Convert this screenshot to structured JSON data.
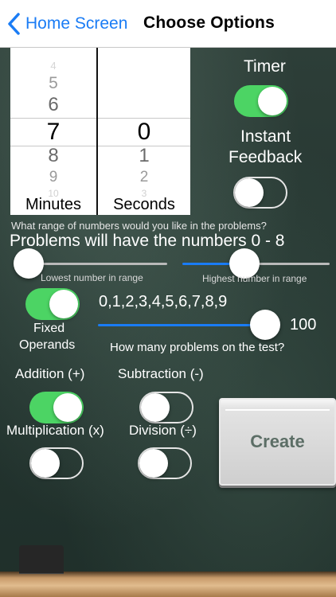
{
  "nav": {
    "back_label": "Home Screen",
    "title": "Choose Options"
  },
  "picker": {
    "minutes_label": "Minutes",
    "seconds_label": "Seconds",
    "minutes_values": [
      "4",
      "5",
      "6",
      "7",
      "8",
      "9",
      "10"
    ],
    "seconds_values": [
      "0",
      "1",
      "2",
      "3"
    ],
    "minutes_selected": "7",
    "seconds_selected": "0"
  },
  "timer": {
    "label": "Timer",
    "on": true
  },
  "instant_feedback": {
    "label_line1": "Instant",
    "label_line2": "Feedback",
    "on": false
  },
  "range": {
    "question": "What range of numbers would you like in the problems?",
    "summary": "Problems will have the numbers 0 - 8",
    "lowest_label": "Lowest number in range",
    "highest_label": "Highest number in range",
    "lowest_value": 0,
    "highest_value": 8
  },
  "fixed_operands": {
    "label_line1": "Fixed",
    "label_line2": "Operands",
    "on": true,
    "values": "0,1,2,3,4,5,6,7,8,9"
  },
  "problems": {
    "question": "How many problems on the test?",
    "count": "100"
  },
  "operations": {
    "addition": {
      "label": "Addition (+)",
      "on": true
    },
    "subtraction": {
      "label": "Subtraction (-)",
      "on": false
    },
    "multiplication": {
      "label": "Multiplication (x)",
      "on": false
    },
    "division": {
      "label": "Division (÷)",
      "on": false
    }
  },
  "create": {
    "label": "Create"
  },
  "colors": {
    "accent_blue": "#1a7cf5",
    "toggle_on": "#4cd464",
    "chalkboard": "#2b3b35"
  }
}
